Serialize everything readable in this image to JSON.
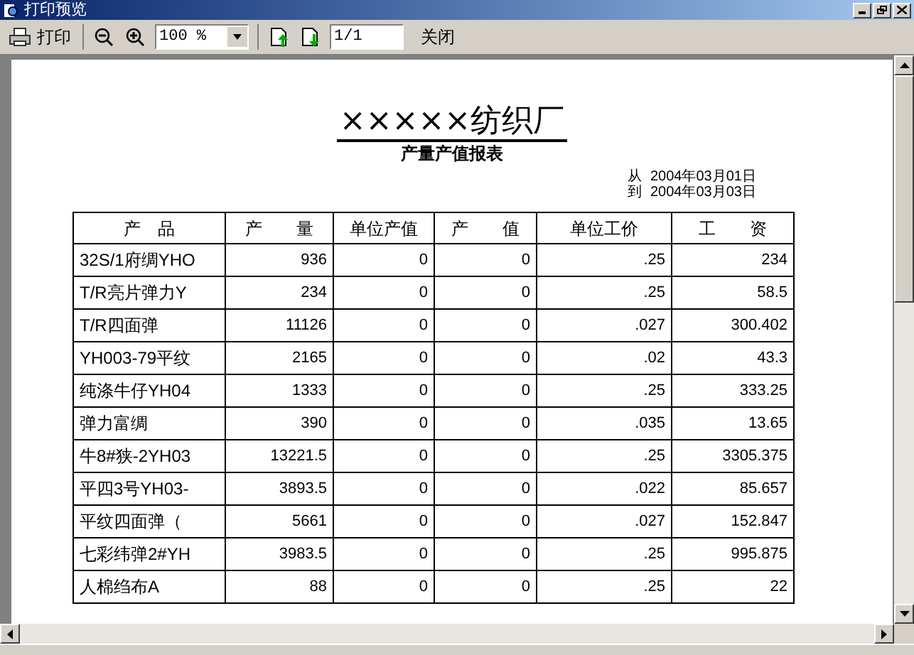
{
  "window": {
    "title": "打印预览"
  },
  "toolbar": {
    "print_label": "打印",
    "zoom_value": "100 %",
    "page_value": "1/1",
    "close_label": "关闭"
  },
  "report": {
    "title": "×××××纺织厂",
    "subtitle": "产量产值报表",
    "date_from_label": "从",
    "date_from": "2004年03月01日",
    "date_to_label": "到",
    "date_to": "2004年03月03日",
    "columns": [
      "产　品",
      "产　　量",
      "单位产值",
      "产　　值",
      "单位工价",
      "工　　资"
    ],
    "rows": [
      [
        "32S/1府绸YHO",
        "936",
        "0",
        "0",
        ".25",
        "234"
      ],
      [
        "T/R亮片弹力Y",
        "234",
        "0",
        "0",
        ".25",
        "58.5"
      ],
      [
        "T/R四面弹",
        "11126",
        "0",
        "0",
        ".027",
        "300.402"
      ],
      [
        "YH003-79平纹",
        "2165",
        "0",
        "0",
        ".02",
        "43.3"
      ],
      [
        "纯涤牛仔YH04",
        "1333",
        "0",
        "0",
        ".25",
        "333.25"
      ],
      [
        "弹力富绸",
        "390",
        "0",
        "0",
        ".035",
        "13.65"
      ],
      [
        "牛8#狭-2YH03",
        "13221.5",
        "0",
        "0",
        ".25",
        "3305.375"
      ],
      [
        "平四3号YH03-",
        "3893.5",
        "0",
        "0",
        ".022",
        "85.657"
      ],
      [
        "平纹四面弹（",
        "5661",
        "0",
        "0",
        ".027",
        "152.847"
      ],
      [
        "七彩纬弹2#YH",
        "3983.5",
        "0",
        "0",
        ".25",
        "995.875"
      ],
      [
        "人棉绉布A",
        "88",
        "0",
        "0",
        ".25",
        "22"
      ]
    ]
  }
}
